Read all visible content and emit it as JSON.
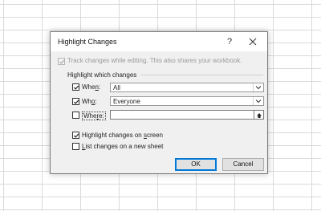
{
  "dialog": {
    "title": "Highlight Changes",
    "help_symbol": "?",
    "track_changes": {
      "label": "Track changes while editing. This also shares your workbook.",
      "checked": true,
      "enabled": false
    },
    "group_label": "Highlight which changes",
    "when": {
      "label_mnemonic": "n",
      "label_rest": ":",
      "label_prefix": "Whe",
      "checked": true,
      "value": "All"
    },
    "who": {
      "label_prefix": "Wh",
      "label_mnemonic": "o",
      "label_rest": ":",
      "checked": true,
      "value": "Everyone"
    },
    "where": {
      "label_prefix": "Whe",
      "label_mnemonic": "r",
      "label_rest": "e:",
      "checked": false,
      "value": ""
    },
    "highlight_on_screen": {
      "label_prefix": "Highlight changes on ",
      "label_mnemonic": "s",
      "label_rest": "creen",
      "checked": true
    },
    "list_new_sheet": {
      "label_prefix": "",
      "label_mnemonic": "L",
      "label_rest": "ist changes on a new sheet",
      "checked": false
    },
    "ok_label": "OK",
    "cancel_label": "Cancel"
  },
  "colors": {
    "accent": "#0078d7",
    "dialog_bg": "#f0f0f0",
    "grid": "#dadada"
  },
  "icons": {
    "close": "close-icon",
    "dropdown": "chevron-down-icon",
    "range": "collapse-range-icon",
    "check": "checkmark-icon"
  }
}
